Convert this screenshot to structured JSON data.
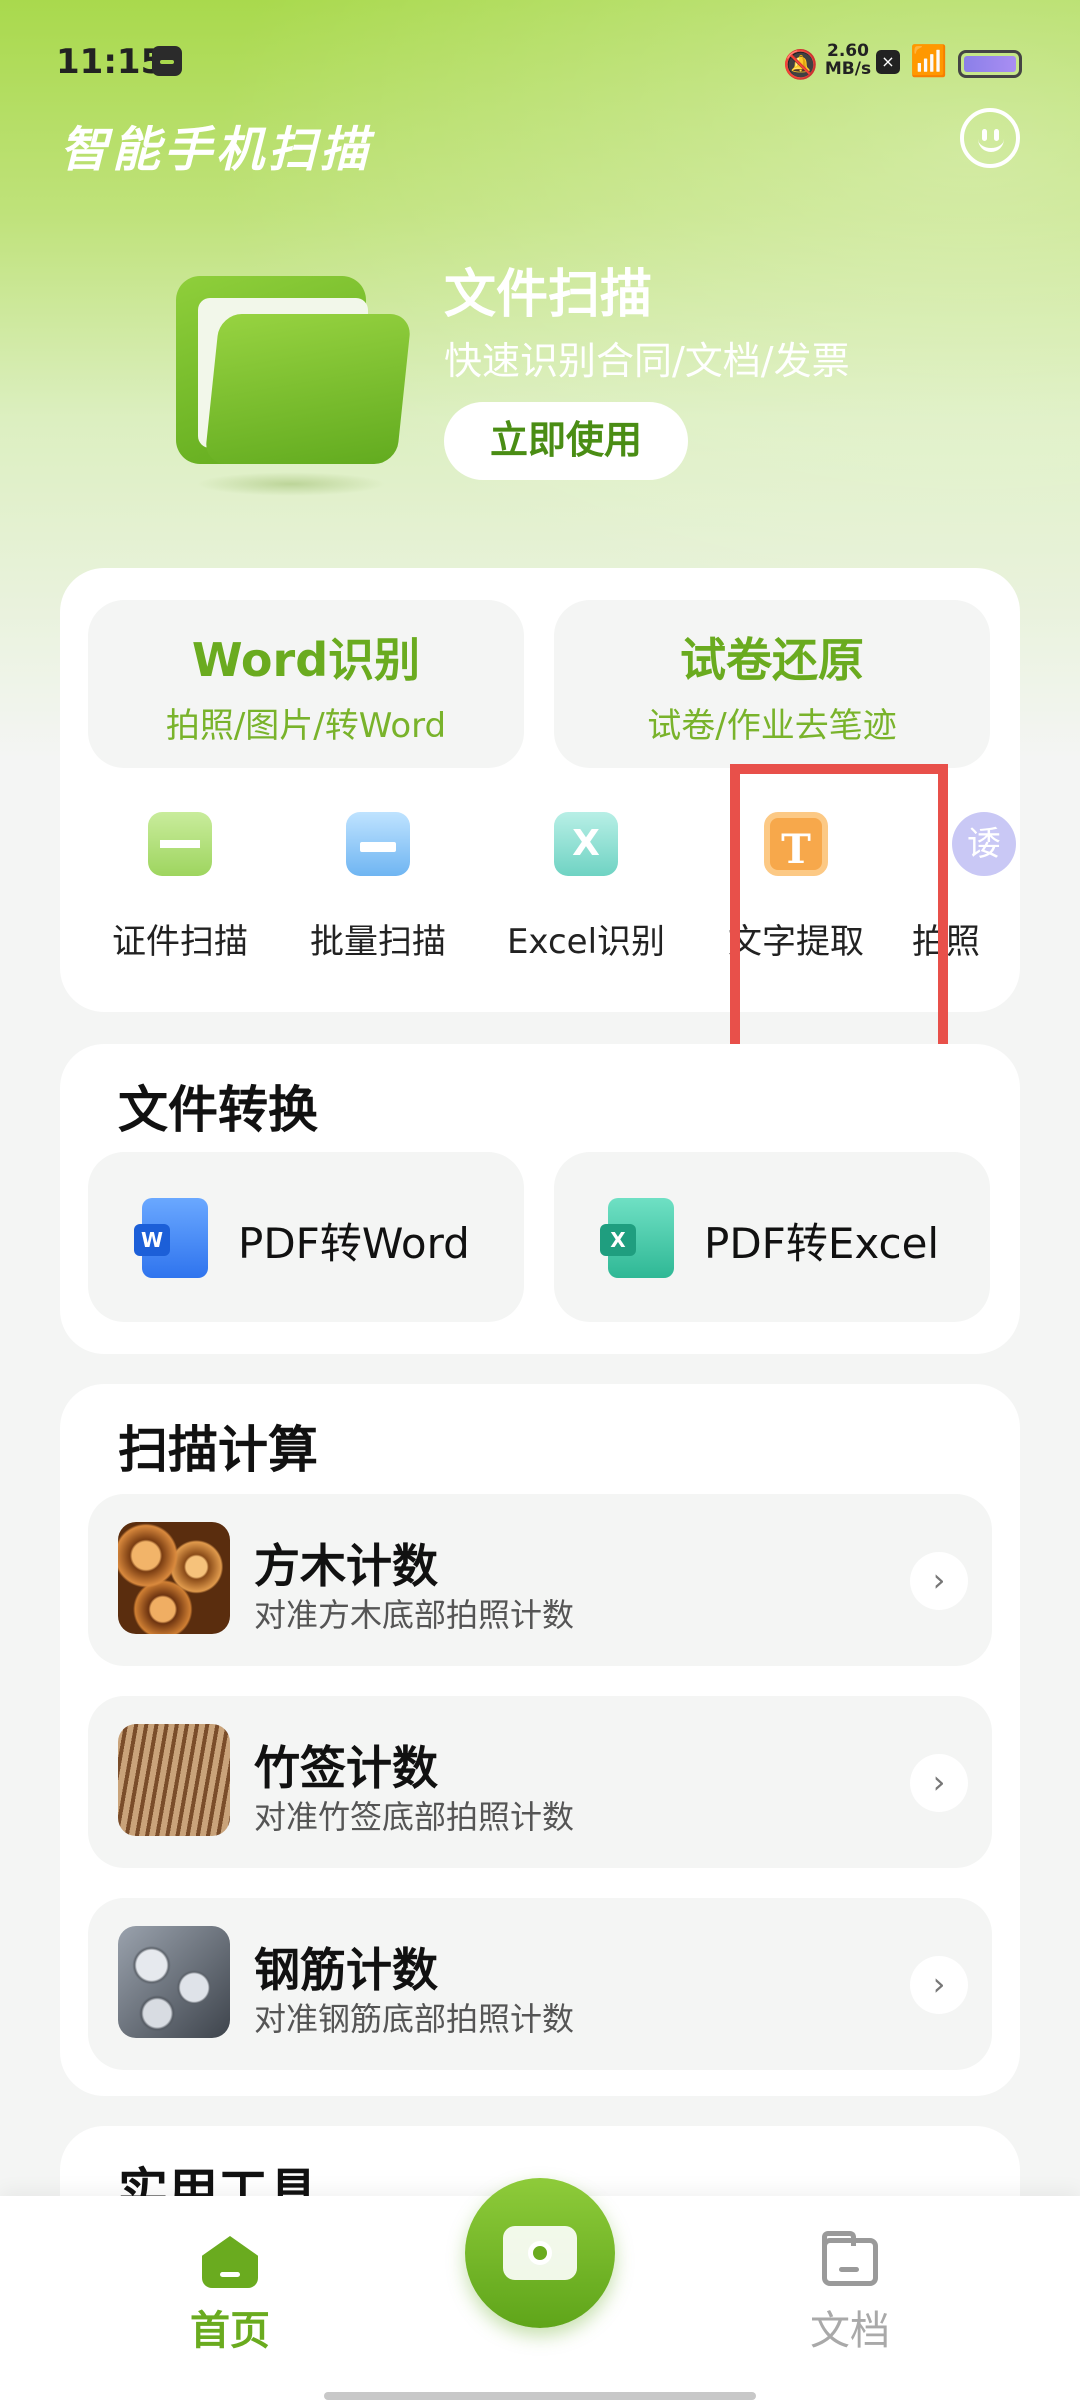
{
  "status_bar": {
    "time": "11:15",
    "net_speed_value": "2.60",
    "net_speed_unit": "MB/s"
  },
  "header": {
    "app_title": "智能手机扫描"
  },
  "banner": {
    "title": "文件扫描",
    "subtitle": "快速识别合同/文档/发票",
    "button_label": "立即使用"
  },
  "features": [
    {
      "title": "Word识别",
      "subtitle": "拍照/图片/转Word"
    },
    {
      "title": "试卷还原",
      "subtitle": "试卷/作业去笔迹"
    }
  ],
  "tools": [
    {
      "label": "证件扫描",
      "icon": "id-card-icon"
    },
    {
      "label": "批量扫描",
      "icon": "batch-scan-icon"
    },
    {
      "label": "Excel识别",
      "icon": "excel-icon",
      "glyph": "X"
    },
    {
      "label": "文字提取",
      "icon": "text-extract-icon",
      "glyph": "T"
    },
    {
      "label": "拍照",
      "icon": "photo-icon",
      "glyph": "诿"
    }
  ],
  "convert": {
    "section_title": "文件转换",
    "items": [
      {
        "label": "PDF转Word",
        "badge": "W",
        "icon": "word-doc-icon"
      },
      {
        "label": "PDF转Excel",
        "badge": "X",
        "icon": "excel-doc-icon"
      }
    ]
  },
  "counting": {
    "section_title": "扫描计算",
    "items": [
      {
        "title": "方木计数",
        "subtitle": "对准方木底部拍照计数"
      },
      {
        "title": "竹签计数",
        "subtitle": "对准竹签底部拍照计数"
      },
      {
        "title": "钢筋计数",
        "subtitle": "对准钢筋底部拍照计数"
      }
    ],
    "chevron": "›"
  },
  "next_section": {
    "title": "实用工具"
  },
  "bottom_nav": {
    "home_label": "首页",
    "docs_label": "文档"
  },
  "colors": {
    "accent": "#6aab1f",
    "highlight": "#e8504a"
  }
}
